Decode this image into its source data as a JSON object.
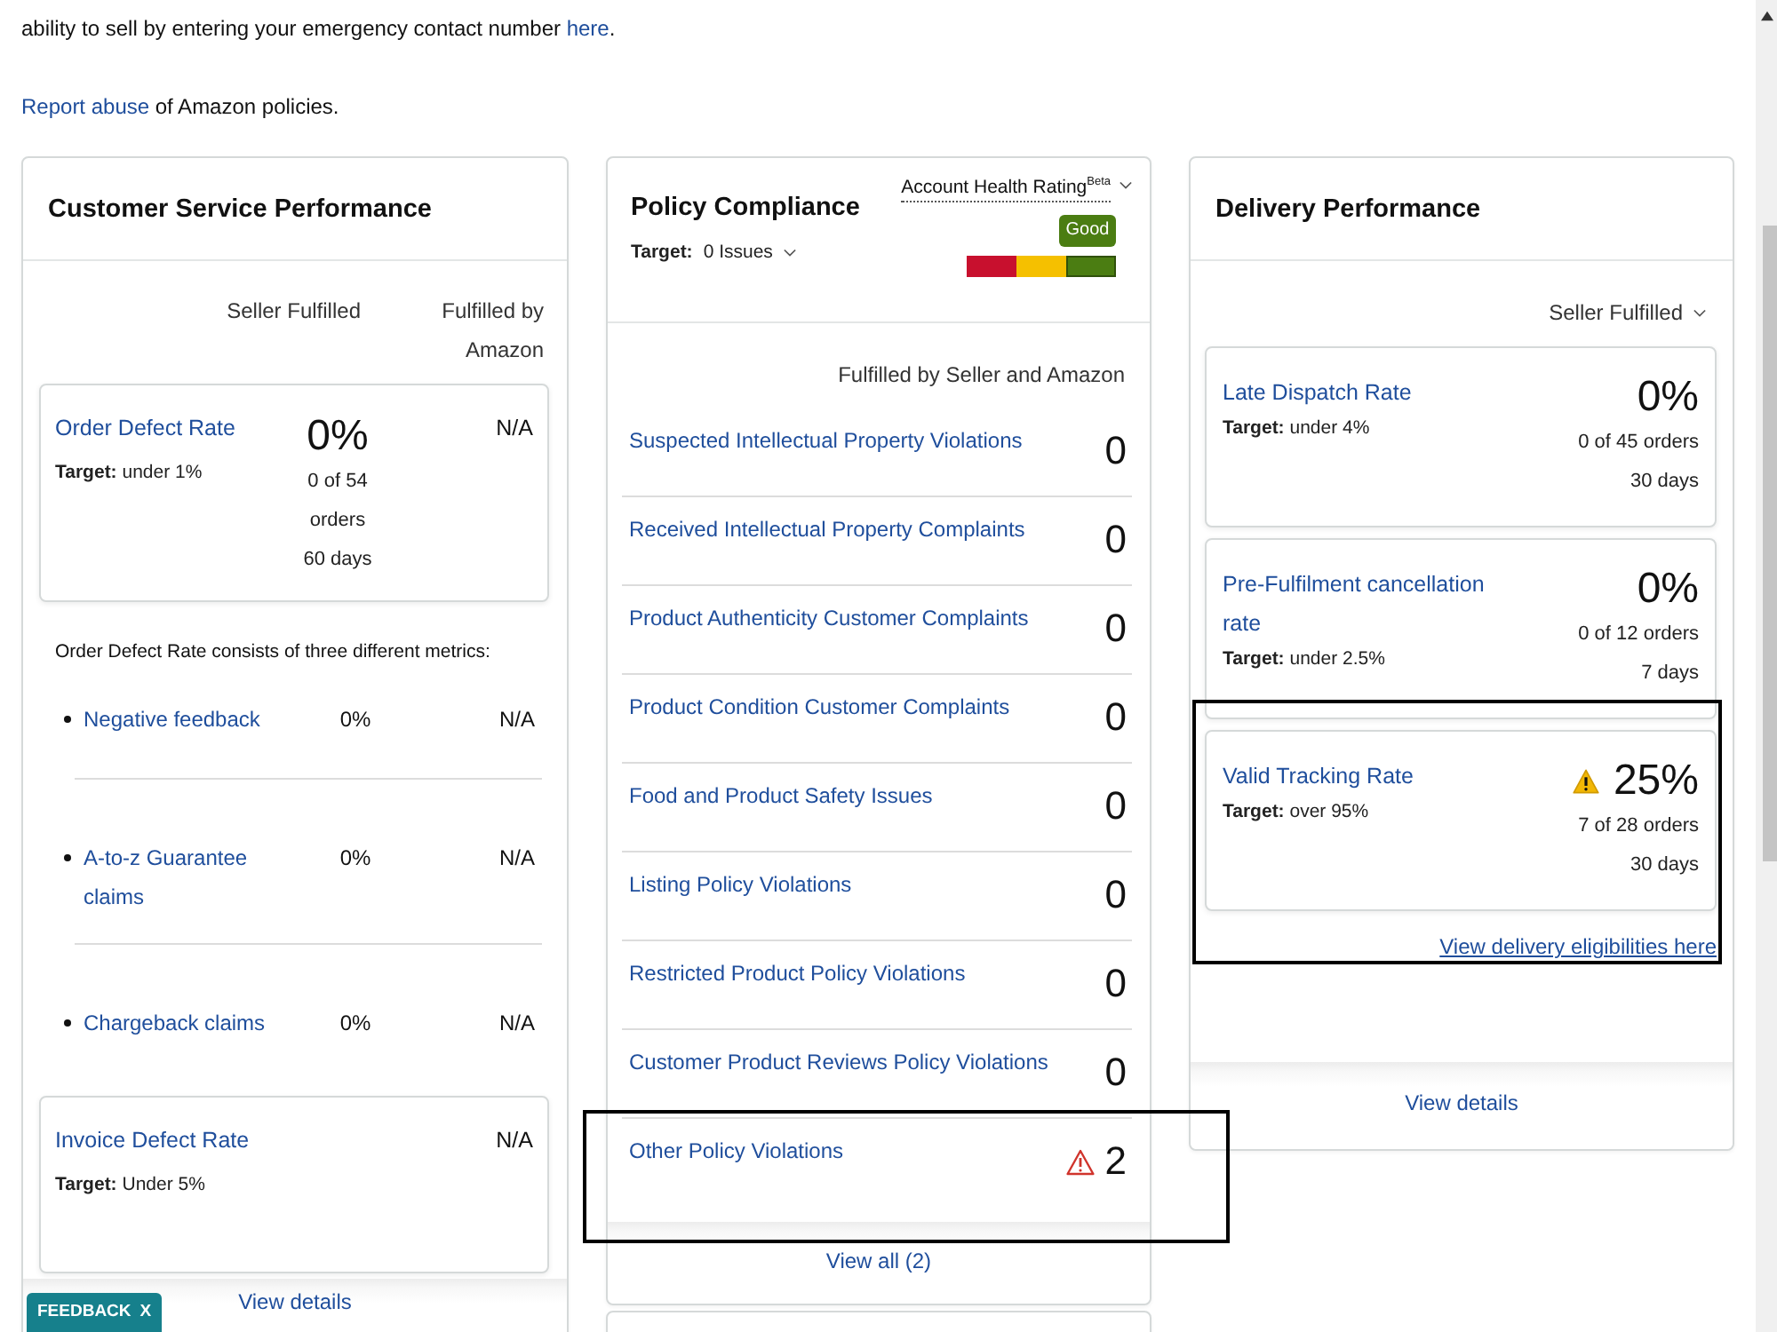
{
  "notice": {
    "text_before": "ability to sell by entering your emergency contact number ",
    "link": "here",
    "text_after": "."
  },
  "report": {
    "link": "Report abuse",
    "text_after": " of Amazon policies."
  },
  "customer_service": {
    "title": "Customer Service Performance",
    "columns": [
      "Seller Fulfilled",
      "Fulfilled by Amazon"
    ],
    "order_defect_rate": {
      "name": "Order Defect Rate",
      "target": "**Target:** under 1%",
      "value": "0%",
      "count": "0 of 54 orders",
      "period": "60 days",
      "amazon": "N/A"
    },
    "metrics_intro": "Order Defect Rate consists of three different metrics:",
    "metrics": [
      {
        "name": "Negative feedback",
        "seller": "0%",
        "amazon": "N/A"
      },
      {
        "name": "A-to-z Guarantee claims",
        "seller": "0%",
        "amazon": "N/A"
      },
      {
        "name": "Chargeback claims",
        "seller": "0%",
        "amazon": "N/A"
      }
    ],
    "invoice_defect_rate": {
      "name": "Invoice Defect Rate",
      "target": "**Target:** Under 5%",
      "amazon": "N/A"
    },
    "view_details": "View details"
  },
  "policy_compliance": {
    "title": "Policy Compliance",
    "target": "**Target:** 0 Issues",
    "rating": {
      "label": "Account Health Rating$^{Beta}$",
      "badge": "Good",
      "segments": [
        {
          "color": "#c8102e",
          "selected": false
        },
        {
          "color": "#f5c000",
          "selected": false
        },
        {
          "color": "#4b7d12",
          "selected": true
        }
      ]
    },
    "column_header": "Fulfilled by Seller and Amazon",
    "rows": [
      {
        "name": "Suspected Intellectual Property Violations",
        "count": "0",
        "alert": false,
        "highlighted": false
      },
      {
        "name": "Received Intellectual Property Complaints",
        "count": "0",
        "alert": false,
        "highlighted": false
      },
      {
        "name": "Product Authenticity Customer Complaints",
        "count": "0",
        "alert": false,
        "highlighted": false
      },
      {
        "name": "Product Condition Customer Complaints",
        "count": "0",
        "alert": false,
        "highlighted": false
      },
      {
        "name": "Food and Product Safety Issues",
        "count": "0",
        "alert": false,
        "highlighted": false
      },
      {
        "name": "Listing Policy Violations",
        "count": "0",
        "alert": false,
        "highlighted": false
      },
      {
        "name": "Restricted Product Policy Violations",
        "count": "0",
        "alert": false,
        "highlighted": false
      },
      {
        "name": "Customer Product Reviews Policy Violations",
        "count": "0",
        "alert": false,
        "highlighted": false
      },
      {
        "name": "Other Policy Violations",
        "count": "2",
        "alert": true,
        "highlighted": true
      }
    ],
    "view_all": "View all (2)"
  },
  "delivery": {
    "title": "Delivery Performance",
    "filter": "Seller Fulfilled",
    "metrics": [
      {
        "name": "Late Dispatch Rate",
        "target": "**Target:** under 4%",
        "value": "0%",
        "count": "0 of 45 orders",
        "period": "30 days",
        "warning": false,
        "highlighted": false
      },
      {
        "name": "Pre-Fulfilment cancellation rate",
        "target": "**Target:** under 2.5%",
        "value": "0%",
        "count": "0 of 12 orders",
        "period": "7 days",
        "warning": false,
        "highlighted": false
      },
      {
        "name": "Valid Tracking Rate",
        "target": "**Target:** over 95%",
        "value": "25%",
        "count": "7 of 28 orders",
        "period": "30 days",
        "warning": true,
        "highlighted": true
      }
    ],
    "eligibility_link": "View delivery eligibilities here",
    "view_details": "View details"
  },
  "feedback_tab": {
    "label": "FEEDBACK",
    "close": "X"
  }
}
